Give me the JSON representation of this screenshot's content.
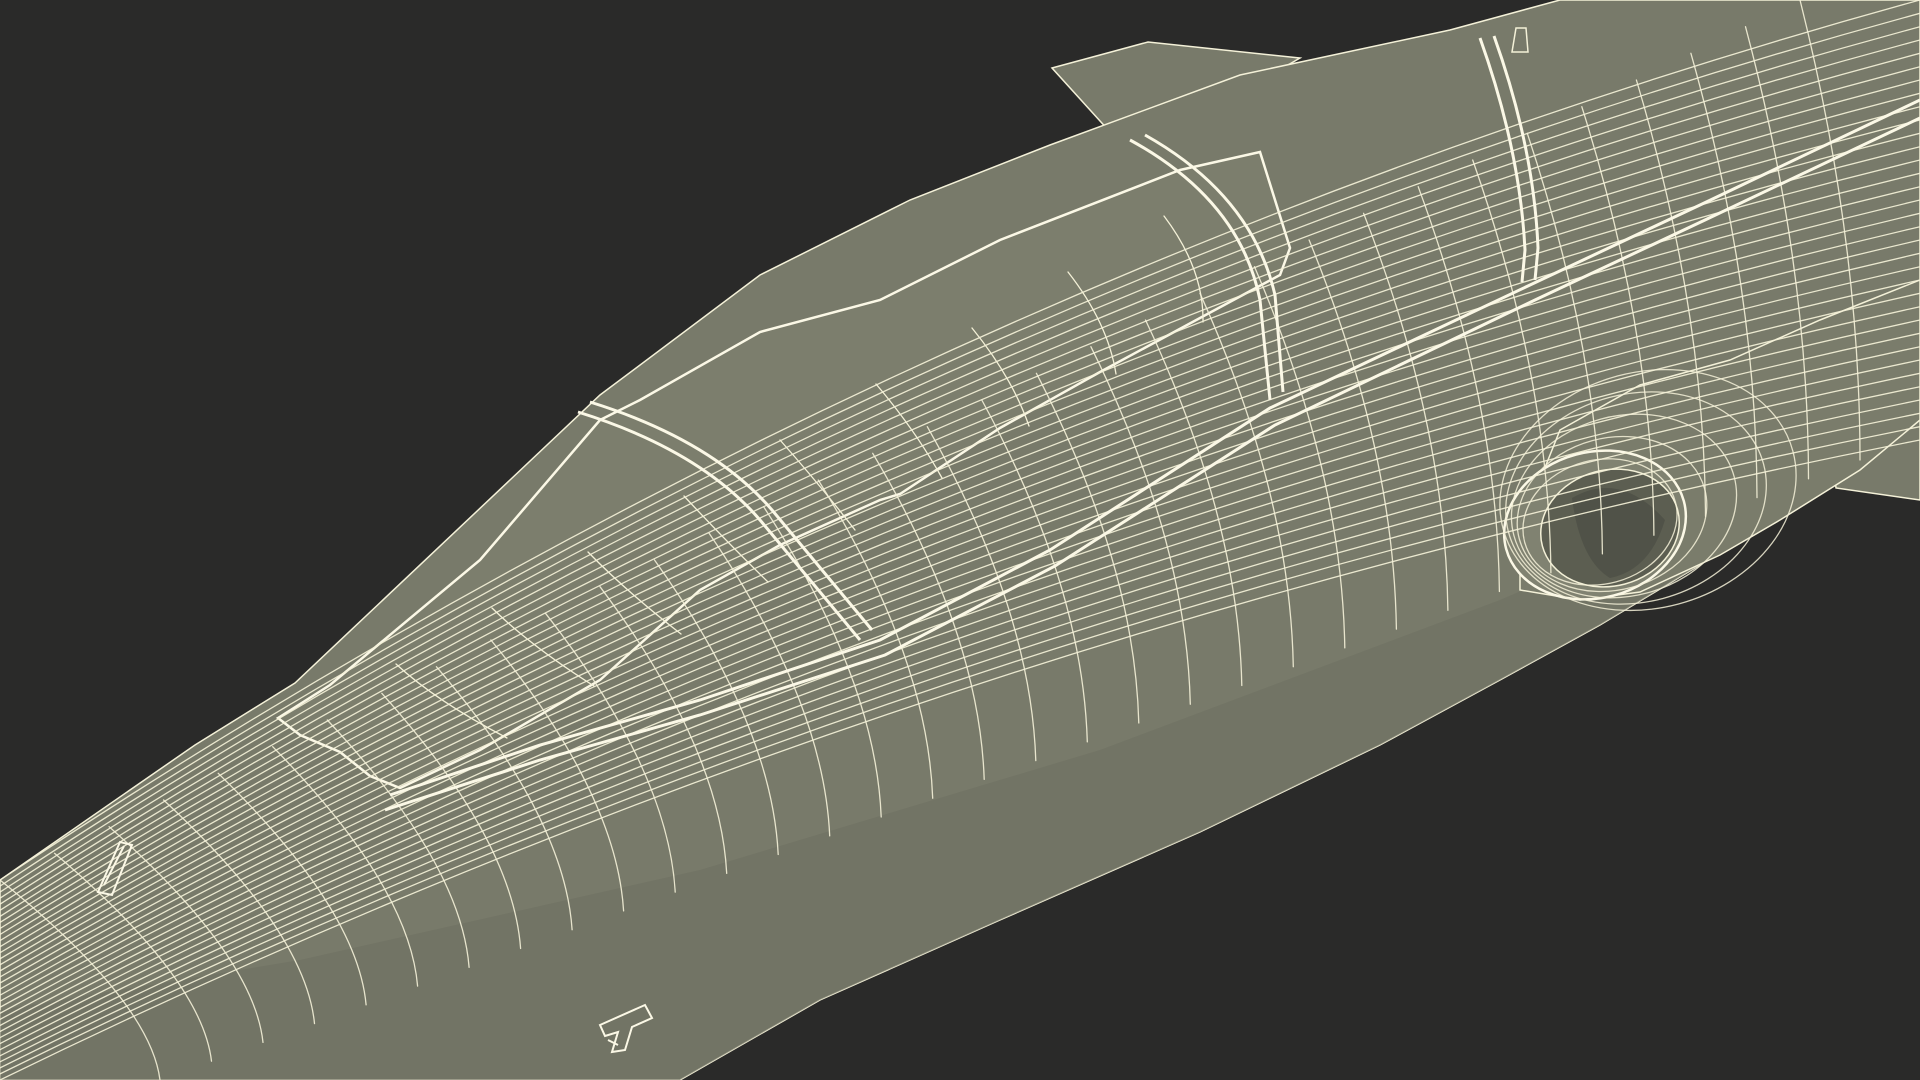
{
  "scene": {
    "subject": "aircraft-fuselage-wireframe",
    "background_color": "#2a2a29",
    "surface_color": "#787a6a",
    "surface_shade_color": "#6a6c5d",
    "wire_color": "#f4f1d8",
    "wire_bold_color": "#fbf8e6",
    "parts": [
      "fuselage",
      "canopy",
      "canopy-frame",
      "dorsal-spine",
      "vertical-fin",
      "engine-intake",
      "horizontal-stabilizer",
      "antenna",
      "access-panels"
    ]
  }
}
